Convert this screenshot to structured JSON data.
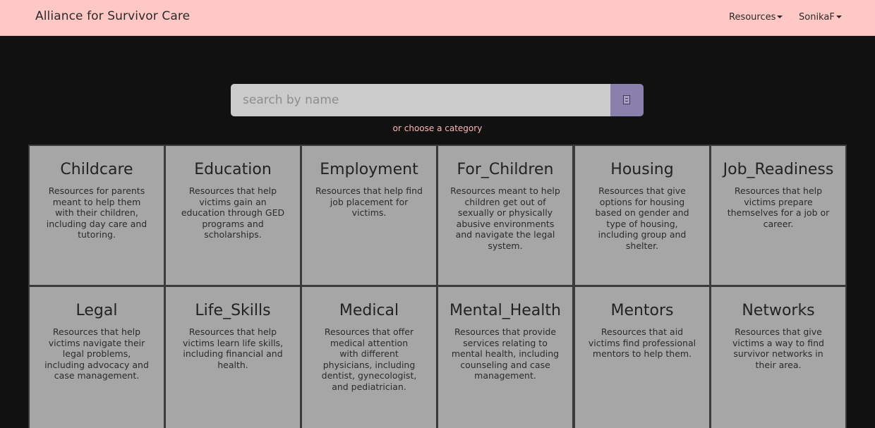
{
  "navbar": {
    "brand": "Alliance for Survivor Care",
    "resources_label": "Resources",
    "user_label": "SonikaF"
  },
  "search": {
    "placeholder": "search by name",
    "choose_category": "or choose a category"
  },
  "colors": {
    "navbar_bg": "#ffc8c5",
    "page_bg": "#111111",
    "search_button": "#8a80ad",
    "card_bg": "#a6a6a6",
    "accent_text": "#ffb8b4"
  },
  "categories": [
    {
      "title": "Childcare",
      "description": "Resources for parents meant to help them with their children, including day care and tutoring."
    },
    {
      "title": "Education",
      "description": "Resources that help victims gain an education through GED programs and scholarships."
    },
    {
      "title": "Employment",
      "description": "Resources that help find job placement for victims."
    },
    {
      "title": "For_Children",
      "description": "Resources meant to help children get out of sexually or physically abusive environments and navigate the legal system."
    },
    {
      "title": "Housing",
      "description": "Resources that give options for housing based on gender and type of housing, including group and shelter."
    },
    {
      "title": "Job_Readiness",
      "description": "Resources that help victims prepare themselves for a job or career."
    },
    {
      "title": "Legal",
      "description": "Resources that help victims navigate their legal problems, including advocacy and case management."
    },
    {
      "title": "Life_Skills",
      "description": "Resources that help victims learn life skills, including financial and health."
    },
    {
      "title": "Medical",
      "description": "Resources that offer medical attention with different physicians, including dentist, gynecologist, and pediatrician."
    },
    {
      "title": "Mental_Health",
      "description": "Resources that provide services relating to mental health, including counseling and case management."
    },
    {
      "title": "Mentors",
      "description": "Resources that aid victims find professional mentors to help them."
    },
    {
      "title": "Networks",
      "description": "Resources that give victims a way to find survivor networks in their area."
    }
  ]
}
